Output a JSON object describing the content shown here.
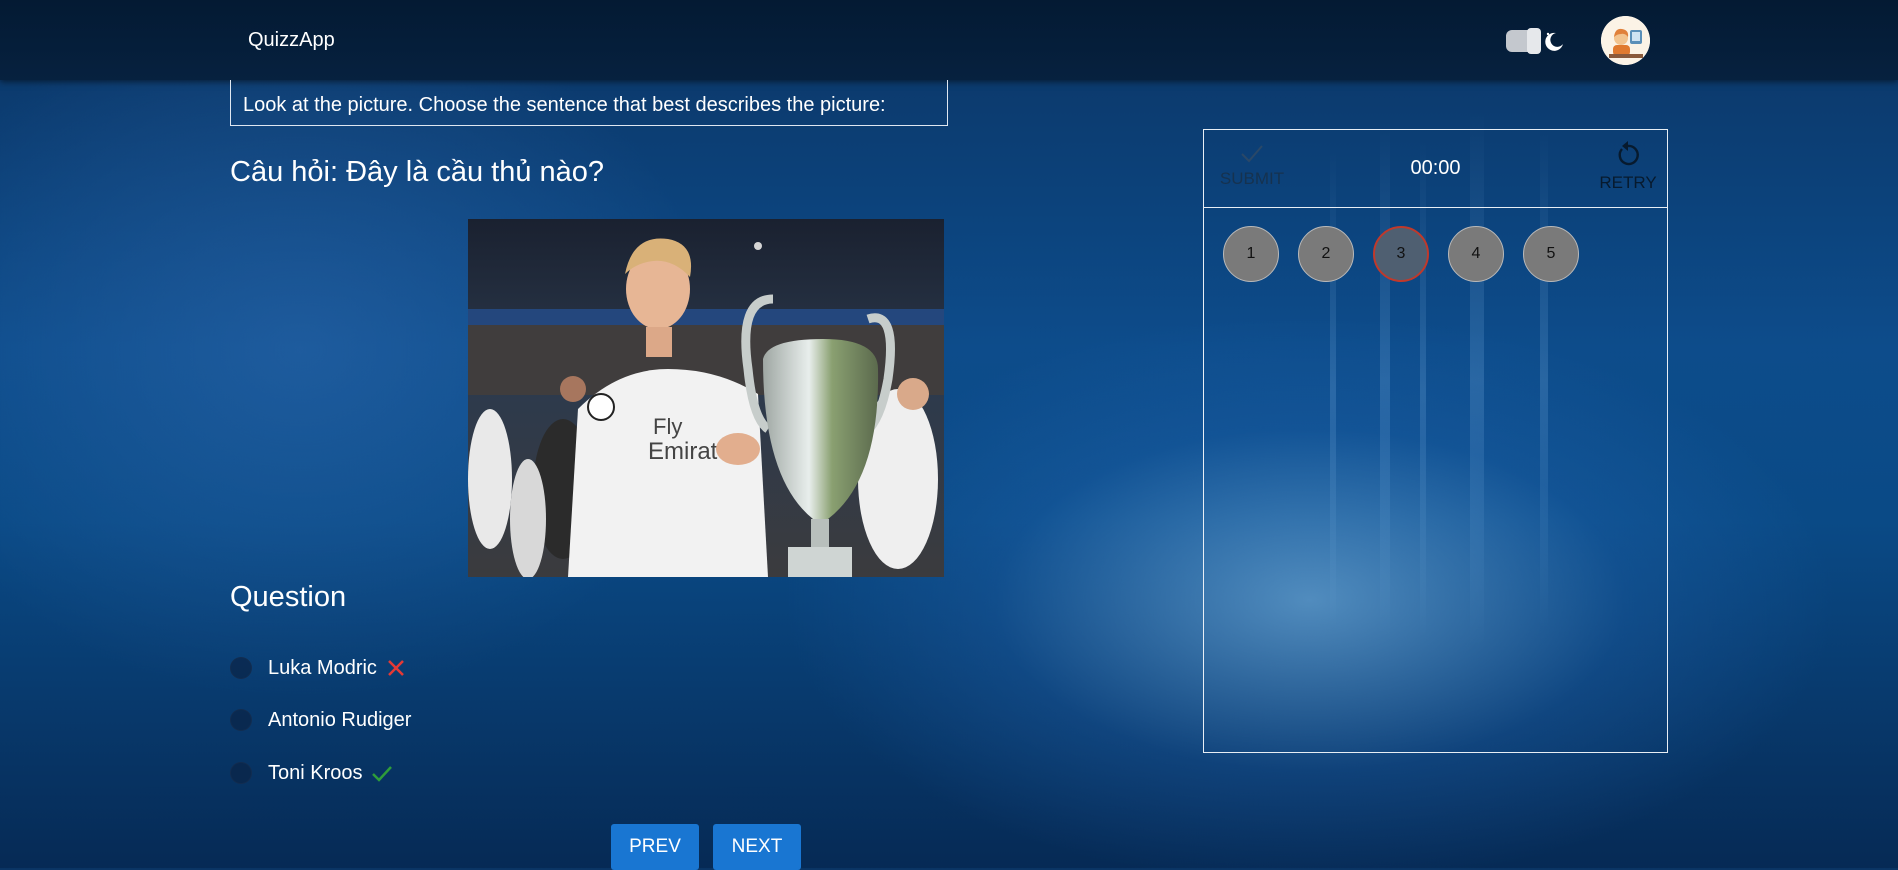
{
  "header": {
    "brand": "QuizzApp",
    "theme_toggle_icon": "moon-icon",
    "avatar_icon": "user-avatar"
  },
  "quiz": {
    "instruction": "Look at the picture. Choose the sentence that best describes the picture:",
    "question_title": "Câu hỏi: Đây là cầu thủ nào?",
    "section_label": "Question",
    "options": [
      {
        "label": "Luka Modric",
        "status": "wrong"
      },
      {
        "label": "Antonio Rudiger",
        "status": "none"
      },
      {
        "label": "Toni Kroos",
        "status": "correct"
      }
    ],
    "prev_label": "PREV",
    "next_label": "NEXT"
  },
  "panel": {
    "submit_label": "SUBMIT",
    "timer": "00:00",
    "retry_label": "RETRY",
    "question_numbers": [
      "1",
      "2",
      "3",
      "4",
      "5"
    ],
    "current_question": "3"
  },
  "colors": {
    "accent": "#1976d2",
    "wrong": "#e53935",
    "correct": "#2e9d3a"
  }
}
